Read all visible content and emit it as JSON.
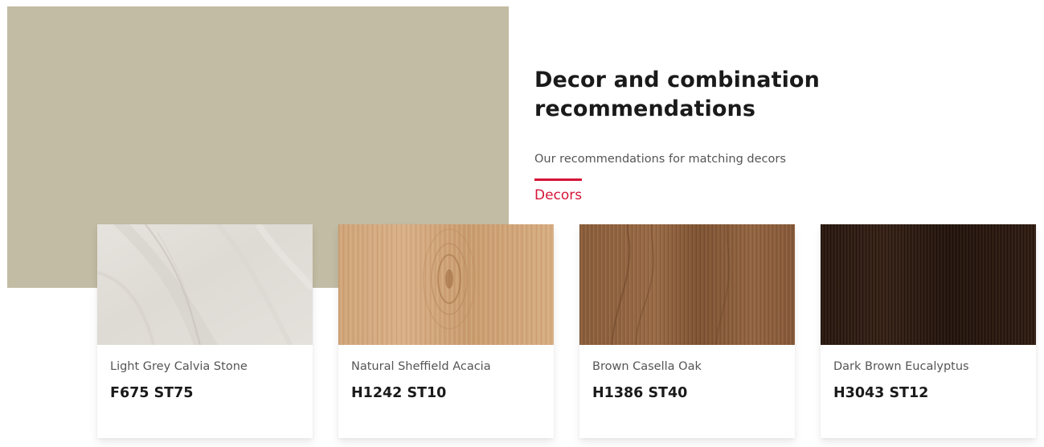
{
  "hero": {
    "swatch_color": "#c2bca4"
  },
  "intro": {
    "title": "Decor and combination recommendations",
    "subtitle": "Our recommendations for matching decors"
  },
  "tabs": [
    {
      "label": "Decors",
      "active": true,
      "accent": "#d51437"
    }
  ],
  "decors": [
    {
      "name": "Light Grey Calvia Stone",
      "code": "F675 ST75",
      "texture": "light-grey-stone"
    },
    {
      "name": "Natural Sheffield Acacia",
      "code": "H1242 ST10",
      "texture": "natural-acacia-wood"
    },
    {
      "name": "Brown Casella Oak",
      "code": "H1386 ST40",
      "texture": "brown-oak-wood"
    },
    {
      "name": "Dark Brown Eucalyptus",
      "code": "H3043 ST12",
      "texture": "dark-brown-eucalyptus-wood"
    }
  ]
}
